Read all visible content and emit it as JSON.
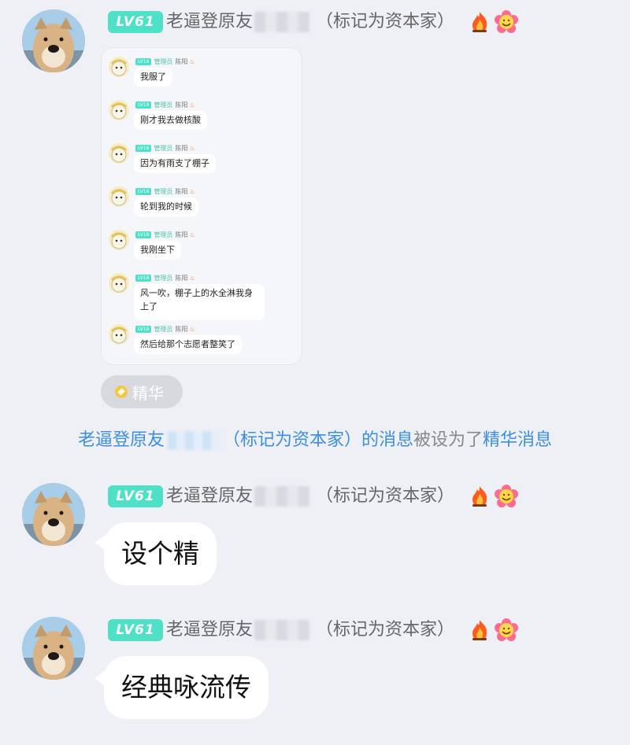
{
  "messages": [
    {
      "sender": {
        "level": "LV61",
        "name_prefix": "老逼登原友",
        "name_suffix": "（标记为资本家）"
      },
      "forwarded": {
        "rows": [
          {
            "level": "LV16",
            "role": "管理员",
            "name": "陈阳",
            "text": "我服了"
          },
          {
            "level": "LV16",
            "role": "管理员",
            "name": "陈阳",
            "text": "刚才我去做核酸"
          },
          {
            "level": "LV16",
            "role": "管理员",
            "name": "陈阳",
            "text": "因为有雨支了棚子"
          },
          {
            "level": "LV16",
            "role": "管理员",
            "name": "陈阳",
            "text": "轮到我的时候"
          },
          {
            "level": "LV16",
            "role": "管理员",
            "name": "陈阳",
            "text": "我刚坐下"
          },
          {
            "level": "LV16",
            "role": "管理员",
            "name": "陈阳",
            "text": "风一吹，棚子上的水全淋我身上了"
          },
          {
            "level": "LV16",
            "role": "管理员",
            "name": "陈阳",
            "text": "然后给那个志愿者整笑了"
          }
        ]
      },
      "essence_label": "精华"
    },
    {
      "sender": {
        "level": "LV61",
        "name_prefix": "老逼登原友",
        "name_suffix": "（标记为资本家）"
      },
      "text": "设个精"
    },
    {
      "sender": {
        "level": "LV61",
        "name_prefix": "老逼登原友",
        "name_suffix": "（标记为资本家）"
      },
      "text": "经典咏流传"
    }
  ],
  "system_notice": {
    "name_prefix": "老逼登原友",
    "name_suffix": "（标记为资本家）",
    "middle1": "的消息",
    "middle2": "被设为了",
    "end": "精华消息"
  },
  "colors": {
    "background": "#eef0f5",
    "level_badge": "#4fe0c8",
    "link_blue": "#3a8ee6",
    "bubble": "#ffffff",
    "essence_tag": "#d7d9de"
  },
  "icons": [
    "fire-icon",
    "smiley-flower-icon",
    "essence-diamond-icon"
  ]
}
